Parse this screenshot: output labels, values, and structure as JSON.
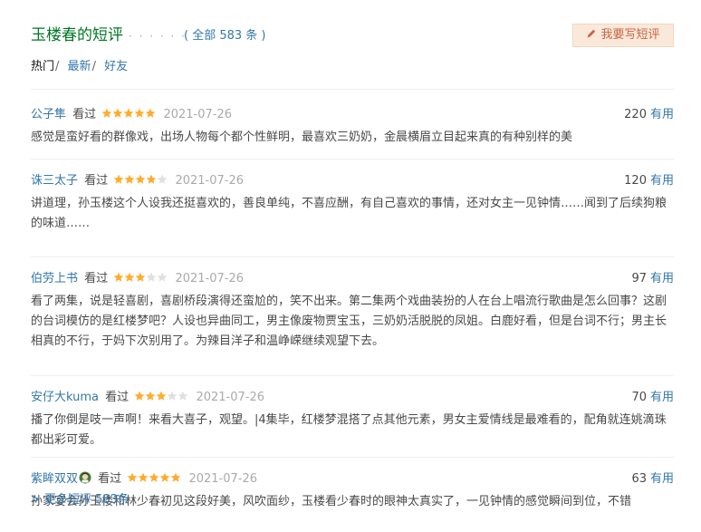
{
  "header": {
    "title": "玉楼春的短评",
    "dots": "· · · · · ·",
    "count": "( 全部 583 条 )",
    "write_button": "我要写短评"
  },
  "tabs": [
    {
      "label": "热门",
      "active": true
    },
    {
      "label": "最新",
      "active": false
    },
    {
      "label": "好友",
      "active": false
    }
  ],
  "tab_separator": "/",
  "watched_label": "看过",
  "useful_label": "有用",
  "star_colors": {
    "on": "#ffac2d",
    "off": "#e0e0e0"
  },
  "comments": [
    {
      "user": "公子隼",
      "rating": 5,
      "date": "2021-07-26",
      "votes": "220",
      "content": "感觉是蛮好看的群像戏，出场人物每个都个性鲜明，最喜欢三奶奶，金晨横眉立目起来真的有种别样的美"
    },
    {
      "user": "诛三太子",
      "rating": 4,
      "date": "2021-07-26",
      "votes": "120",
      "content": "讲道理，孙玉楼这个人设我还挺喜欢的，善良单纯，不喜应酬，有自己喜欢的事情，还对女主一见钟情……闻到了后续狗粮的味道……"
    },
    {
      "user": "伯劳上书",
      "rating": 3,
      "date": "2021-07-26",
      "votes": "97",
      "content": "看了两集，说是轻喜剧，喜剧桥段演得还蛮尬的，笑不出来。第二集两个戏曲装扮的人在台上唱流行歌曲是怎么回事？这剧的台词模仿的是红楼梦吧？人设也异曲同工，男主像废物贾宝玉，三奶奶活脱脱的凤姐。白鹿好看，但是台词不行；男主长相真的不行，于妈下次别用了。为辣目洋子和温峥嵘继续观望下去。"
    },
    {
      "user": "安仔大kuma",
      "rating": 3,
      "date": "2021-07-26",
      "votes": "70",
      "content": "播了你倒是吱一声啊！来看大喜子，观望。|4集毕，红楼梦混搭了点其他元素，男女主爱情线是最难看的，配角就连姚滴珠都出彩可爱。"
    },
    {
      "user": "紫眸双双",
      "rating": 5,
      "date": "2021-07-26",
      "votes": "63",
      "content": "孙家宴会孙玉楼和林少春初见这段好美，风吹面纱，玉楼看少春时的眼神太真实了，一见钟情的感觉瞬间到位，不错"
    }
  ],
  "more_link": "> 更多短评 583条"
}
